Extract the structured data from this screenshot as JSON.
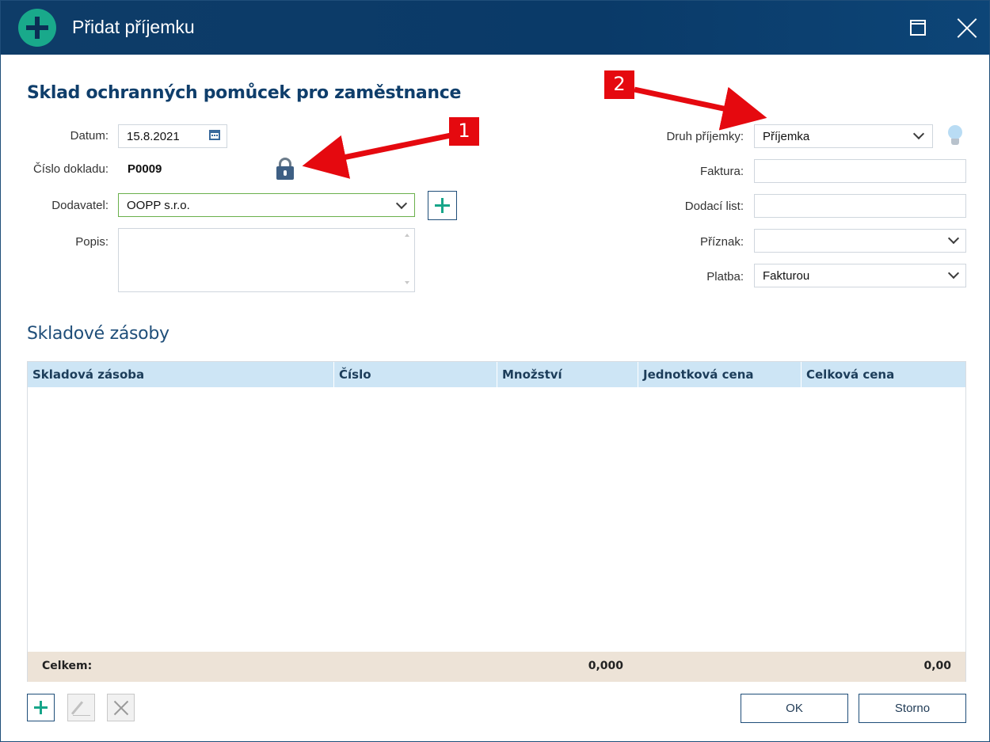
{
  "window": {
    "title": "Přidat příjemku"
  },
  "heading": "Sklad ochranných pomůcek pro zaměstnance",
  "form_left": {
    "date_label": "Datum:",
    "date_value": "15.8.2021",
    "doc_number_label": "Číslo dokladu:",
    "doc_number_value": "P0009",
    "supplier_label": "Dodavatel:",
    "supplier_value": "OOPP s.r.o.",
    "description_label": "Popis:",
    "description_value": ""
  },
  "form_right": {
    "type_label": "Druh příjemky:",
    "type_value": "Příjemka",
    "invoice_label": "Faktura:",
    "invoice_value": "",
    "delivery_note_label": "Dodací list:",
    "delivery_note_value": "",
    "flag_label": "Příznak:",
    "flag_value": "",
    "payment_label": "Platba:",
    "payment_value": "Fakturou"
  },
  "stock_section": {
    "title": "Skladové zásoby",
    "columns": [
      "Skladová zásoba",
      "Číslo",
      "Množství",
      "Jednotková cena",
      "Celková cena"
    ],
    "rows": [],
    "footer": {
      "label": "Celkem:",
      "quantity_total": "0,000",
      "price_total": "0,00"
    }
  },
  "buttons": {
    "ok": "OK",
    "cancel": "Storno"
  },
  "callouts": {
    "one": "1",
    "two": "2"
  },
  "colors": {
    "titlebar": "#0e3c68",
    "accent_green": "#17a589",
    "callout_red": "#e5090f",
    "grid_header": "#cde5f5",
    "grid_footer": "#ede3d7"
  },
  "icons": [
    "add-icon",
    "maximize-icon",
    "close-icon",
    "calendar-icon",
    "lock-icon",
    "chevron-down-icon",
    "lightbulb-icon",
    "edit-icon",
    "delete-icon"
  ]
}
